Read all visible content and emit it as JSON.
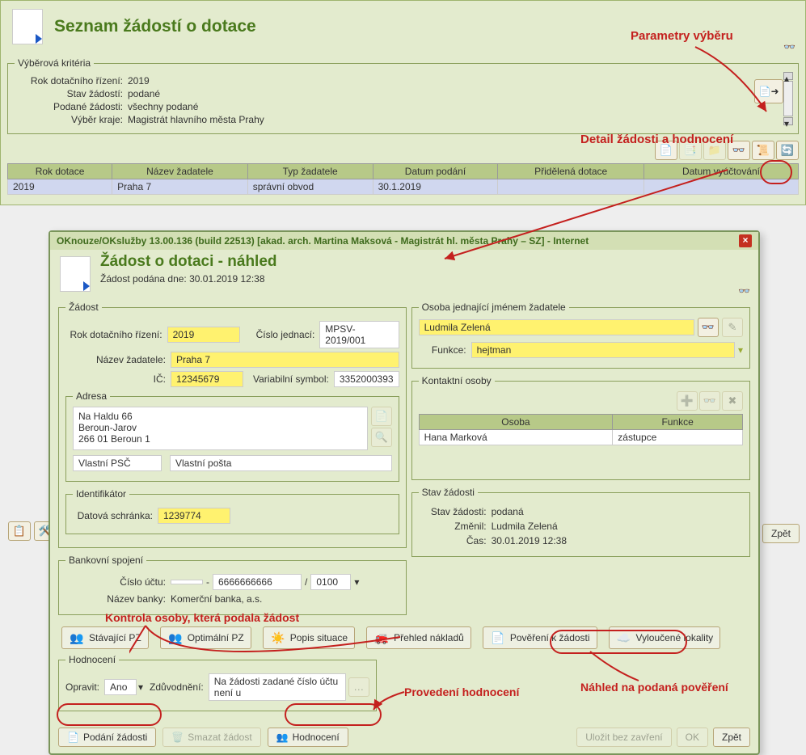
{
  "listPage": {
    "title": "Seznam žádostí o dotace",
    "criteria": {
      "legend": "Výběrová kritéria",
      "rows": [
        {
          "label": "Rok dotačního řízení:",
          "value": "2019"
        },
        {
          "label": "Stav žádostí:",
          "value": "podané"
        },
        {
          "label": "Podané žádosti:",
          "value": "všechny podané"
        },
        {
          "label": "Výběr kraje:",
          "value": "Magistrát hlavního města Prahy"
        }
      ]
    },
    "grid": {
      "headers": [
        "Rok dotace",
        "Název žadatele",
        "Typ žadatele",
        "Datum podání",
        "Přidělená dotace",
        "Datum vyúčtování"
      ],
      "row": [
        "2019",
        "Praha 7",
        "správní obvod",
        "30.1.2019",
        "",
        ""
      ]
    },
    "backLabel": "Zpět"
  },
  "annotations": {
    "paramVyberu": "Parametry výběru",
    "detailZadosti": "Detail žádosti a hodnocení",
    "kontrolaOsoby": "Kontrola osoby, která podala žádost",
    "provedeniHodnoceni": "Provedení hodnocení",
    "nahledPovereni": "Náhled na podaná pověření"
  },
  "modal": {
    "windowTitle": "OKnouze/OKslužby 13.00.136 (build 22513)  [akad. arch. Martina Maksová - Magistrát hl. města Prahy – SZ] - Internet",
    "title": "Žádost o dotaci - náhled",
    "subtitle": "Žádost podána dne: 30.01.2019 12:38",
    "zadost": {
      "legend": "Žádost",
      "rokLabel": "Rok dotačního řízení:",
      "rok": "2019",
      "cisloJednaciLabel": "Číslo jednací:",
      "cisloJednaci": "MPSV-2019/001",
      "nazevLabel": "Název žadatele:",
      "nazev": "Praha 7",
      "icLabel": "IČ:",
      "ic": "12345679",
      "vsLabel": "Variabilní symbol:",
      "vs": "3352000393",
      "addrLegend": "Adresa",
      "addr": "Na Haldu 66\nBeroun-Jarov\n266 01 Beroun 1",
      "vlastniPsc": "Vlastní PSČ",
      "vlastniPosta": "Vlastní pošta",
      "identLegend": "Identifikátor",
      "datovaLabel": "Datová schránka:",
      "datova": "1239774",
      "bankLegend": "Bankovní spojení",
      "cisloUctuLabel": "Číslo účtu:",
      "cisloUctuPrefix": "",
      "cisloUctu": "6666666666",
      "sepDash": "-",
      "sepSlash": "/",
      "kodBanky": "0100",
      "nazevBankyLabel": "Název banky:",
      "nazevBanky": "Komerční banka, a.s."
    },
    "osoba": {
      "legend": "Osoba jednající jménem žadatele",
      "jmeno": "Ludmila Zelená",
      "funkceLabel": "Funkce:",
      "funkce": "hejtman"
    },
    "kontakt": {
      "legend": "Kontaktní osoby",
      "headers": [
        "Osoba",
        "Funkce"
      ],
      "row": [
        "Hana Marková",
        "zástupce"
      ]
    },
    "stav": {
      "legend": "Stav žádosti",
      "stavLabel": "Stav žádosti:",
      "stav": "podaná",
      "zmenilLabel": "Změnil:",
      "zmenil": "Ludmila Zelená",
      "casLabel": "Čas:",
      "cas": "30.01.2019 12:38"
    },
    "buttons": {
      "stavajiciPZ": "Stávající PZ",
      "optimalniPZ": "Optimální PZ",
      "popisSituace": "Popis situace",
      "prehledNakladu": "Přehled nákladů",
      "povereni": "Pověření k žádosti",
      "vylouceneLokality": "Vyloučené lokality"
    },
    "hodnoceni": {
      "legend": "Hodnocení",
      "opravitLabel": "Opravit:",
      "opravit": "Ano",
      "zduvodneniLabel": "Zdůvodnění:",
      "zduvodneni": "Na žádosti zadané číslo účtu není u"
    },
    "footer": {
      "podani": "Podání žádosti",
      "smazat": "Smazat žádost",
      "hodnoceni": "Hodnocení",
      "ulozit": "Uložit bez zavření",
      "ok": "OK",
      "zpet": "Zpět"
    }
  }
}
